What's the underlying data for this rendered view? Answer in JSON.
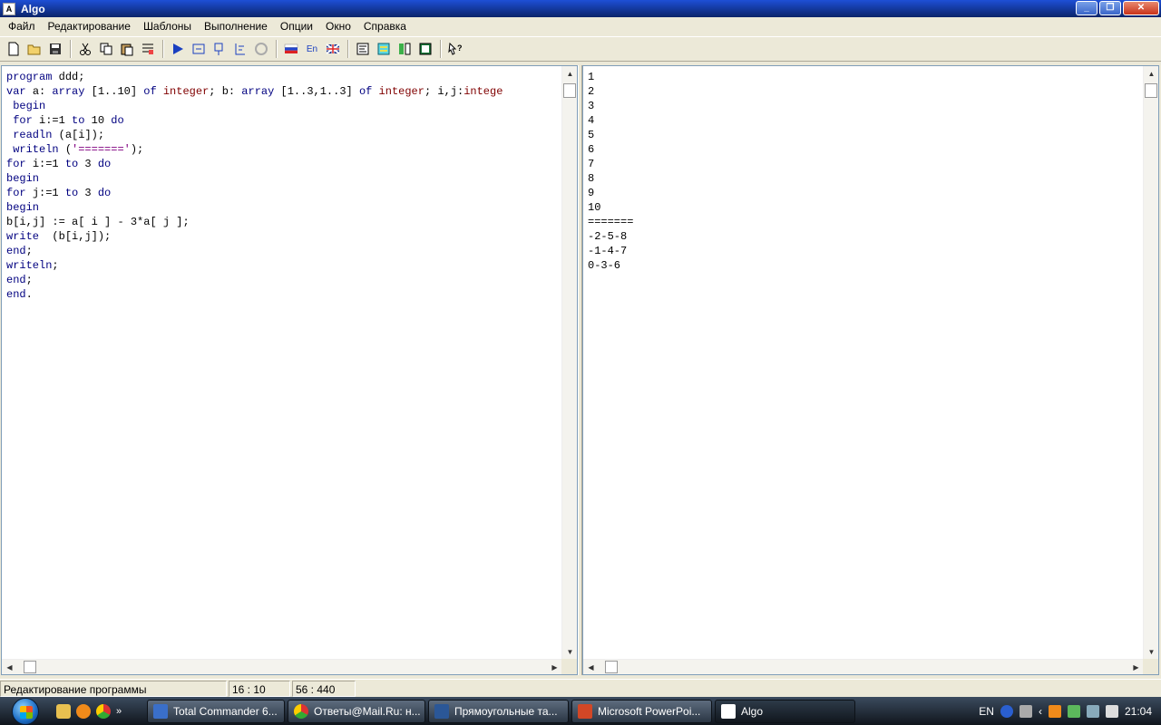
{
  "window": {
    "title": "Algo",
    "app_icon": "algo-app-icon"
  },
  "menu": [
    "Файл",
    "Редактирование",
    "Шаблоны",
    "Выполнение",
    "Опции",
    "Окно",
    "Справка"
  ],
  "toolbar": {
    "lang_en_label": "En",
    "icons": [
      "new-file-icon",
      "open-folder-icon",
      "save-icon",
      "cut-icon",
      "copy-icon",
      "paste-icon",
      "templates-icon",
      "run-icon",
      "step-over-icon",
      "step-into-icon",
      "trace-icon",
      "stop-icon",
      "russian-flag-icon",
      "english-text-icon",
      "uk-flag-icon",
      "code-view-icon",
      "watch-icon",
      "split-view-icon",
      "output-view-icon",
      "context-help-icon"
    ]
  },
  "editor": {
    "lines": [
      "program ddd;",
      "var a: array [1..10] of integer; b: array [1..3,1..3] of integer; i,j:intege",
      " begin",
      " for i:=1 to 10 do",
      " readln (a[i]);",
      " writeln ('=======');",
      "for i:=1 to 3 do",
      "begin",
      "for j:=1 to 3 do",
      "begin",
      "b[i,j] := a[ i ] - 3*a[ j ];",
      "write  (b[i,j]);",
      "end;",
      "writeln;",
      "end;",
      "end."
    ]
  },
  "output": {
    "lines": [
      "1",
      "2",
      "3",
      "4",
      "5",
      "6",
      "7",
      "8",
      "9",
      "10",
      "=======",
      "-2-5-8",
      "-1-4-7",
      "0-3-6"
    ]
  },
  "status": {
    "mode": "Редактирование программы",
    "cursor": "16 : 10",
    "size": "56 : 440"
  },
  "taskbar": {
    "tasks": [
      {
        "label": "Total Commander 6...",
        "icon": "floppy-icon",
        "color": "#3a6fc9"
      },
      {
        "label": "Ответы@Mail.Ru: н...",
        "icon": "chrome-icon",
        "color": "#e0b020"
      },
      {
        "label": "Прямоугольные та...",
        "icon": "word-icon",
        "color": "#2b5797"
      },
      {
        "label": "Microsoft PowerPoi...",
        "icon": "powerpoint-icon",
        "color": "#d24726"
      },
      {
        "label": "Algo",
        "icon": "algo-icon",
        "color": "#ffffff"
      }
    ],
    "tray": {
      "lang": "EN",
      "clock": "21:04"
    }
  }
}
